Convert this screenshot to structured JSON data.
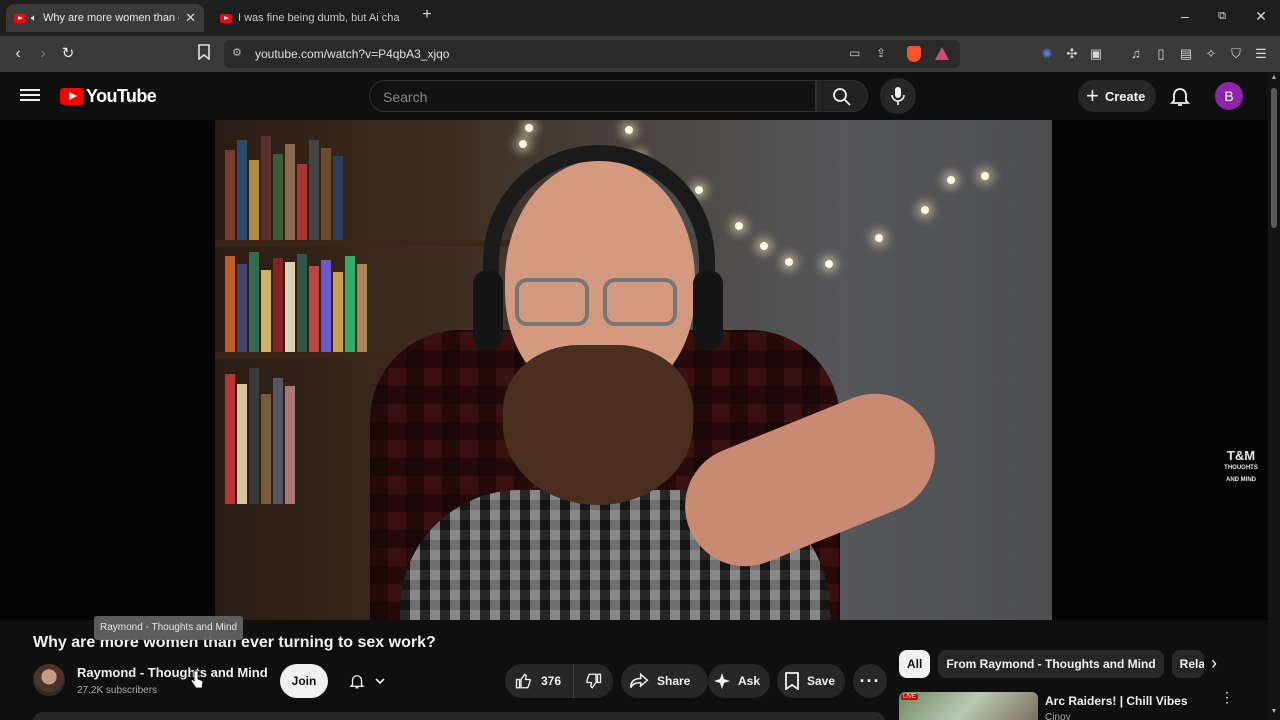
{
  "browser": {
    "tabs": [
      {
        "title": "Why are more women than ever",
        "active": true
      },
      {
        "title": "I was fine being dumb, but Ai changed",
        "active": false
      }
    ],
    "new_tab_glyph": "+",
    "url": "youtube.com/watch?v=P4qbA3_xjqo",
    "window_controls": [
      "minimize",
      "maximize",
      "close"
    ]
  },
  "header": {
    "logo_text": "YouTube",
    "search_placeholder": "Search",
    "create_label": "Create",
    "avatar_letter": "B",
    "avatar_color": "#8e24aa"
  },
  "player": {
    "watermark_main": "T&M",
    "watermark_sub": "THOUGHTS AND MIND"
  },
  "video": {
    "title": "Why are more women than ever turning to sex work?",
    "tooltip": "Raymond - Thoughts and Mind",
    "channel_name": "Raymond - Thoughts and Mind",
    "subscribers": "27.2K subscribers",
    "join_label": "Join",
    "likes": "376",
    "share_label": "Share",
    "ask_label": "Ask",
    "save_label": "Save"
  },
  "sidebar": {
    "chips": [
      "All",
      "From Raymond - Thoughts and Mind",
      "Related"
    ],
    "active_chip": "All",
    "recommendation": {
      "title": "Arc Raiders! | Chill Vibes",
      "channel": "Cinoy",
      "badge": "LIVE"
    }
  },
  "colors": {
    "brand_red": "#ff0000",
    "background": "#0f0f0f",
    "pill": "#272727"
  }
}
